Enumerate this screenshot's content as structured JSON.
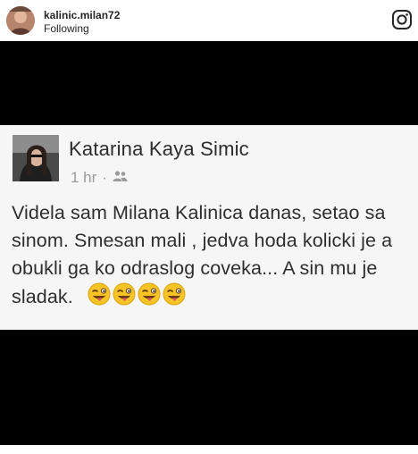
{
  "header": {
    "username": "kalinic.milan72",
    "status": "Following",
    "instagram_icon": "instagram-icon"
  },
  "post": {
    "author_name": "Katarina Kaya Simic",
    "time": "1 hr",
    "separator": "·",
    "audience_icon": "friends-icon",
    "text": "Videla sam Milana Kalinica danas, setao sa sinom. Smesan mali , jedva hoda kolicki je a obukli ga ko odraslog coveka... A sin mu je sladak.",
    "emoji_icon": "winking-face-with-tongue-icon",
    "emoji_count": 4
  },
  "colors": {
    "letterbox": "#000000",
    "post_background": "#f6f6f6",
    "emoji_yellow": "#f7c325"
  }
}
